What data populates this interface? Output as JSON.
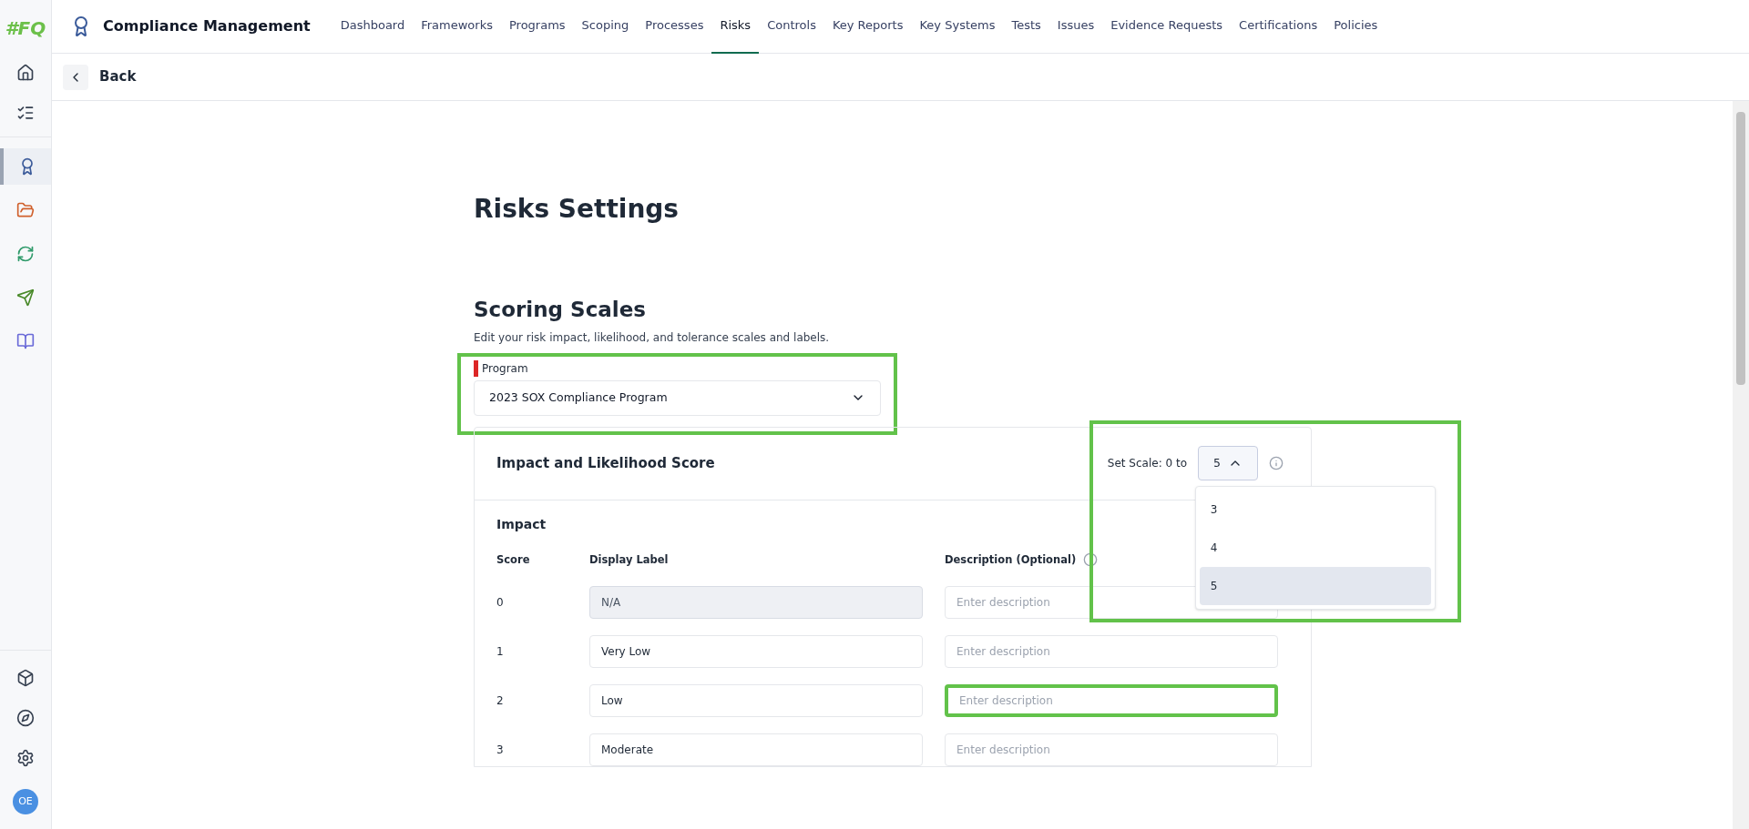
{
  "app": {
    "logo": "#FQ",
    "title": "Compliance Management"
  },
  "nav": [
    {
      "label": "Dashboard",
      "selected": false
    },
    {
      "label": "Frameworks",
      "selected": false
    },
    {
      "label": "Programs",
      "selected": false
    },
    {
      "label": "Scoping",
      "selected": false
    },
    {
      "label": "Processes",
      "selected": false
    },
    {
      "label": "Risks",
      "selected": true
    },
    {
      "label": "Controls",
      "selected": false
    },
    {
      "label": "Key Reports",
      "selected": false
    },
    {
      "label": "Key Systems",
      "selected": false
    },
    {
      "label": "Tests",
      "selected": false
    },
    {
      "label": "Issues",
      "selected": false
    },
    {
      "label": "Evidence Requests",
      "selected": false
    },
    {
      "label": "Certifications",
      "selected": false
    },
    {
      "label": "Policies",
      "selected": false
    }
  ],
  "sidebar": {
    "apps": [
      {
        "kind": "badge",
        "selected": true
      },
      {
        "kind": "folder",
        "selected": false
      },
      {
        "kind": "sync",
        "selected": false
      },
      {
        "kind": "plane",
        "selected": false
      },
      {
        "kind": "book",
        "selected": false
      }
    ],
    "avatar": "OE"
  },
  "back": "Back",
  "page_title": "Risks Settings",
  "section": {
    "title": "Scoring Scales",
    "subtitle": "Edit your risk impact, likelihood, and tolerance scales and labels.",
    "program": {
      "label": "Program",
      "required": true,
      "value": "2023 SOX Compliance Program"
    }
  },
  "card": {
    "title": "Impact and Likelihood Score",
    "scale_label": "Set Scale: 0 to",
    "scale_value": "5",
    "scale_expanded": true,
    "scale_options": [
      {
        "label": "3",
        "selected": false
      },
      {
        "label": "4",
        "selected": false
      },
      {
        "label": "5",
        "selected": true
      }
    ],
    "subsection": "Impact",
    "columns": [
      "Score",
      "Display Label",
      "Description (Optional)"
    ],
    "rows": [
      {
        "score": "0",
        "label": "N/A",
        "disabled": true,
        "placeholder": "Enter description",
        "highlighted": false
      },
      {
        "score": "1",
        "label": "Very Low",
        "disabled": false,
        "placeholder": "Enter description",
        "highlighted": false
      },
      {
        "score": "2",
        "label": "Low",
        "disabled": false,
        "placeholder": "Enter description",
        "highlighted": true
      },
      {
        "score": "3",
        "label": "Moderate",
        "disabled": false,
        "placeholder": "Enter description",
        "highlighted": false
      }
    ]
  }
}
